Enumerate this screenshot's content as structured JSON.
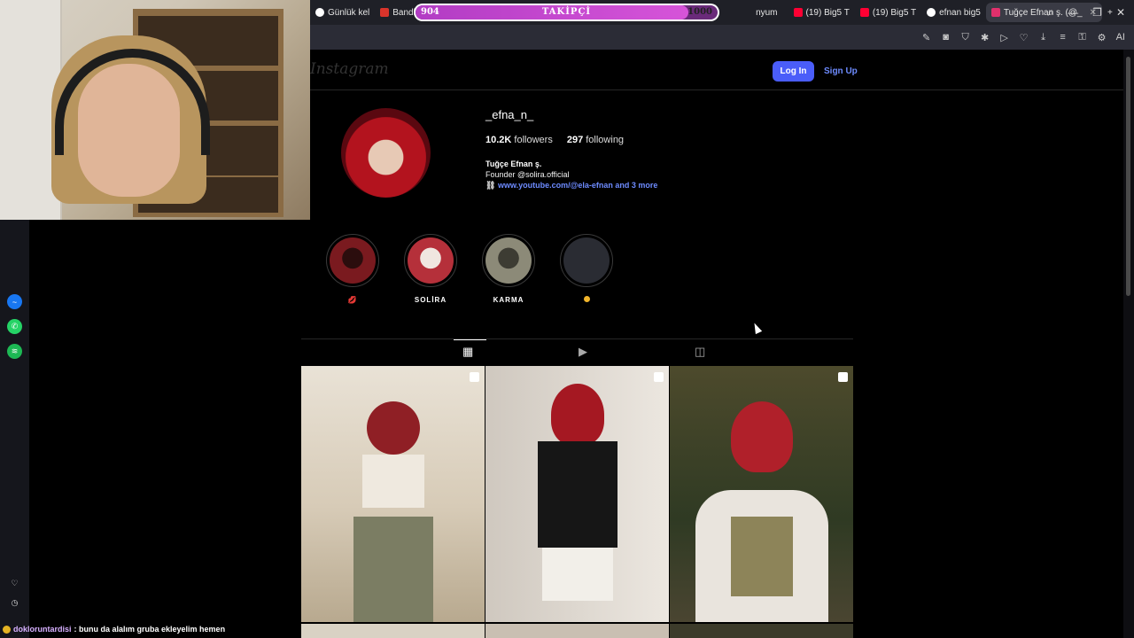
{
  "browser": {
    "tabs": [
      {
        "label": "Günlük kel",
        "color": "#ffffff"
      },
      {
        "label": "Bandle - G",
        "color": "#d9342b"
      },
      {
        "label": "nyum",
        "color": "#e0554f"
      },
      {
        "label": "(19) Big5 T",
        "color": "#ff0033"
      },
      {
        "label": "(19) Big5 T",
        "color": "#ff0033"
      },
      {
        "label": "efnan big5",
        "color": "#ffffff"
      },
      {
        "label": "Tuğçe Efnan ş. (@_",
        "color": "#e1306c"
      }
    ],
    "new_tab": "+",
    "window_controls": {
      "search": "⌕",
      "minimize": "—",
      "restore": "❐",
      "close": "✕"
    },
    "ai_label": "AI"
  },
  "follower_goal": {
    "label": "TAKİPÇİ",
    "current": "904",
    "goal": "1000",
    "progress": 0.904
  },
  "instagram": {
    "logo": "Instagram",
    "login_label": "Log In",
    "signup_label": "Sign Up",
    "username": "_efna_n_",
    "followers_count": "10.2K",
    "followers_label": "followers",
    "following_count": "297",
    "following_label": "following",
    "full_name": "Tuğçe Efnan ş.",
    "bio": "Founder @solira.official",
    "link": "www.youtube.com/@ela-efnan and 3 more",
    "highlights": [
      {
        "label": "💋",
        "color_a": "#7a1a1f",
        "color_b": "#2b0d0d"
      },
      {
        "label": "SOLİRA",
        "color_a": "#b5303a",
        "color_b": "#f0e6e0"
      },
      {
        "label": "KARMA",
        "color_a": "#8c8a78",
        "color_b": "#3d3c33"
      },
      {
        "label": "",
        "color_a": "#2a2c33",
        "color_b": "#2a2c33"
      }
    ]
  },
  "chat": {
    "user": "dokloruntardisi",
    "message": ": bunu da alalım gruba ekleyelim hemen"
  }
}
